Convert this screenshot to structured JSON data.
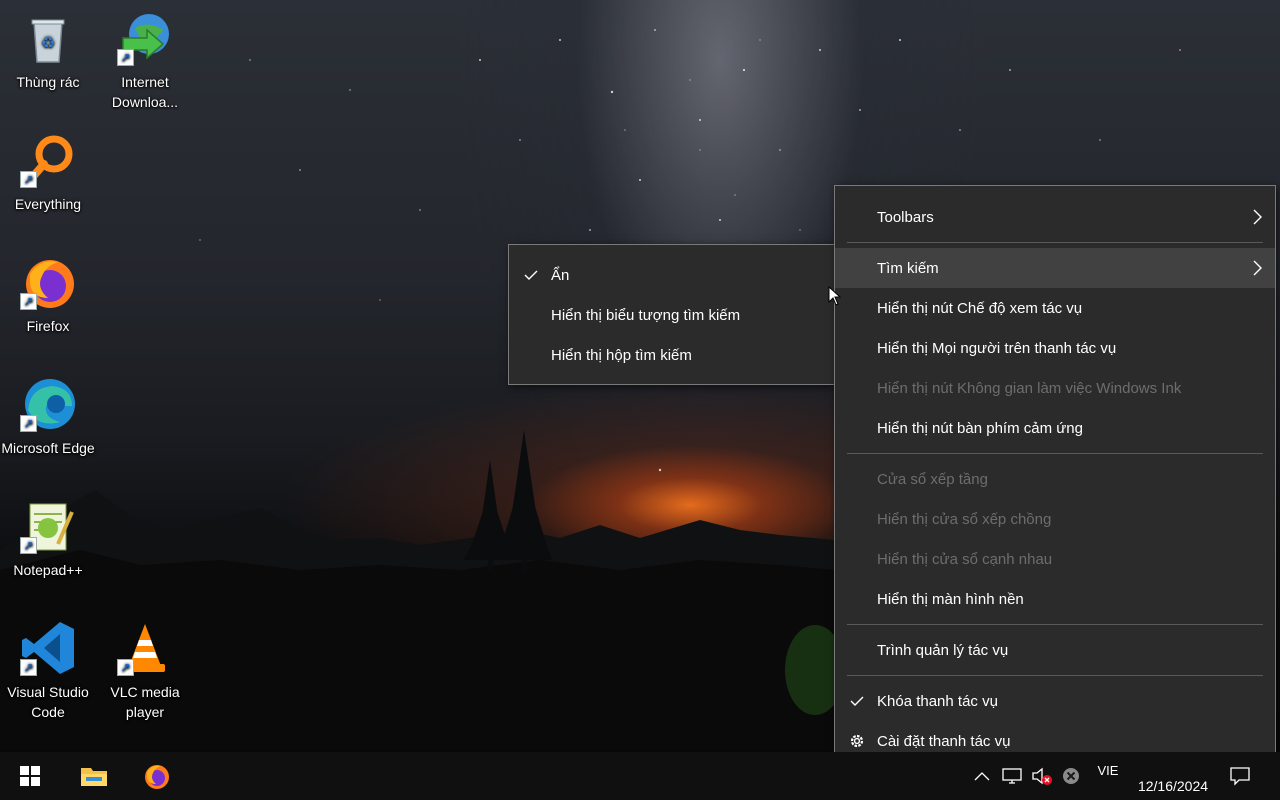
{
  "desktop": {
    "icons": [
      {
        "label": "Thùng rác",
        "icon": "recycle-bin-icon"
      },
      {
        "label": "Internet Downloa...",
        "icon": "internet-download-manager-icon"
      },
      {
        "label": "Everything",
        "icon": "everything-search-icon"
      },
      {
        "label": "Firefox",
        "icon": "firefox-icon"
      },
      {
        "label": "Microsoft Edge",
        "icon": "edge-icon"
      },
      {
        "label": "Notepad++",
        "icon": "notepadpp-icon"
      },
      {
        "label": "Visual Studio Code",
        "icon": "vscode-icon"
      },
      {
        "label": "VLC media player",
        "icon": "vlc-icon"
      }
    ]
  },
  "submenu": {
    "items": [
      {
        "label": "Ẩn",
        "checked": true
      },
      {
        "label": "Hiển thị biểu tượng tìm kiếm"
      },
      {
        "label": "Hiển thị hộp tìm kiếm"
      }
    ]
  },
  "context_menu": {
    "toolbars": "Toolbars",
    "search": "Tìm kiếm",
    "task_view": "Hiển thị nút Chế độ xem tác vụ",
    "people": "Hiển thị Mọi người trên thanh tác vụ",
    "ink": "Hiển thị nút Không gian làm việc Windows Ink",
    "touch_keyboard": "Hiển thị nút bàn phím cảm ứng",
    "cascade": "Cửa sổ xếp tầng",
    "stacked": "Hiển thị cửa sổ xếp chồng",
    "side_by_side": "Hiển thị cửa sổ cạnh nhau",
    "show_desktop": "Hiển thị màn hình nền",
    "task_manager": "Trình quản lý tác vụ",
    "lock_taskbar": "Khóa thanh tác vụ",
    "taskbar_settings": "Cài đặt thanh tác vụ"
  },
  "taskbar": {
    "language": "VIE",
    "date": "12/16/2024"
  },
  "colors": {
    "menu_bg": "#2b2b2b",
    "menu_hover": "#414141",
    "disabled_text": "#6d6d6d",
    "taskbar_bg": "#101010"
  }
}
